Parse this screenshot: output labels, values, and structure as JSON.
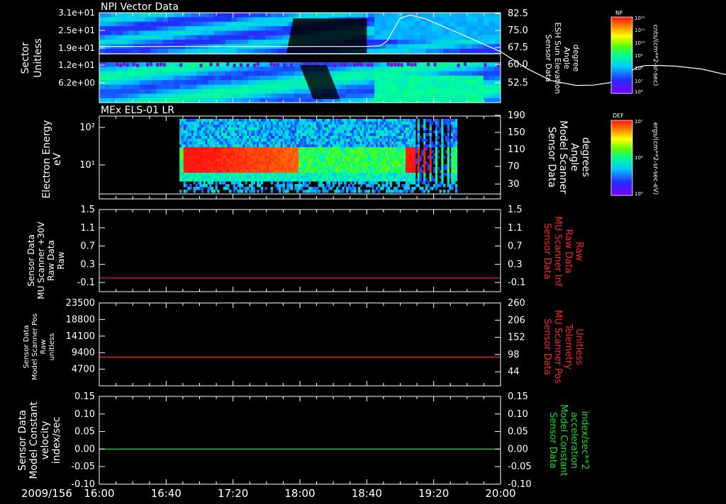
{
  "footer": {
    "date_label": "2009/156",
    "time_ticks": [
      "16:00",
      "16:40",
      "17:20",
      "18:00",
      "18:40",
      "19:20",
      "20:00"
    ]
  },
  "colorbars": [
    {
      "code": "NF",
      "tick_top": "10¹²",
      "tick_bottom": "10⁸",
      "ticks": [
        "10¹²",
        "10¹¹",
        "10¹⁰",
        "10⁹",
        "10⁸",
        "10⁷",
        "10⁶"
      ],
      "unit": "cnts/(cm**2-sr-sec)"
    },
    {
      "code": "DEF",
      "tick_top": "10⁷",
      "tick_bottom": "10⁵",
      "ticks": [
        "10⁷",
        "10⁶",
        "10⁵"
      ],
      "unit": "ergs/(cm**2-sr-sec-eV)"
    }
  ],
  "chart_data": [
    {
      "type": "heatmap",
      "title": "NPI Vector Data",
      "ylabel": [
        "Sector",
        "Unitless"
      ],
      "y_ticks_left": [
        "3.1e+01",
        "2.5e+01",
        "1.9e+01",
        "1.2e+01",
        "6.2e+00"
      ],
      "y_ticks_right": [
        "82.5",
        "75.0",
        "67.5",
        "60.0",
        "52.5"
      ],
      "ylabel_right": [
        "Sensor Data",
        "ESH Sun Elevation",
        "Angle",
        "degree"
      ],
      "overlay_series": {
        "name": "ESH Sun Elevation Angle",
        "x_minutes": [
          0,
          150,
          160,
          168,
          172,
          176,
          180,
          186,
          195,
          215,
          240,
          255,
          270,
          285,
          295,
          305,
          310,
          315,
          318,
          320,
          322,
          326,
          330,
          335,
          345,
          360,
          375,
          385,
          390,
          395,
          400,
          410,
          415,
          418,
          420,
          423,
          428,
          432,
          440
        ],
        "y_degrees": [
          68.2,
          68.2,
          68.2,
          68.5,
          70.5,
          75.5,
          80.5,
          81.8,
          80.2,
          74,
          66,
          59,
          53.5,
          51.4,
          51.5,
          52.5,
          54,
          56,
          57.5,
          58.5,
          59.3,
          59.9,
          60,
          60,
          59.7,
          58.5,
          56,
          53,
          51,
          49.5,
          48.5,
          49,
          54,
          60,
          64,
          68,
          68.2,
          68.2,
          68.2
        ]
      },
      "x_ticks": [
        "16:00",
        "16:40",
        "17:20",
        "18:00",
        "18:40",
        "19:20",
        "20:00"
      ],
      "colorbar": "NF"
    },
    {
      "type": "heatmap",
      "title": "MEx ELS-01 LR",
      "ylabel": [
        "Electron Energy",
        "eV"
      ],
      "y_ticks_left": [
        "10²",
        "10¹"
      ],
      "y_ticks_right": [
        "190",
        "150",
        "110",
        "70",
        "30"
      ],
      "ylabel_right": [
        "Sensor Data",
        "Model Scanner",
        "Angle",
        "degrees"
      ],
      "data_window": {
        "start": "16:48",
        "end": "19:34"
      },
      "high_flux_intervals": [
        {
          "start": "16:50",
          "end": "16:54"
        },
        {
          "start": "16:55",
          "end": "17:58"
        },
        {
          "start": "19:02",
          "end": "19:18"
        }
      ],
      "overlay_series": {
        "name": "Model Scanner Angle",
        "value_degrees": 10
      },
      "colorbar": "DEF"
    },
    {
      "type": "line",
      "ylabel": [
        "Sensor Data",
        "MU Scanner +30V",
        "Raw Data",
        "Raw"
      ],
      "ylabel_right": [
        "Sensor Data",
        "MU Scanner Inf",
        "Raw Data",
        "Raw"
      ],
      "y_ticks_left": [
        "1.5",
        "1.1",
        "0.7",
        "0.3",
        "-0.1"
      ],
      "y_ticks_right": [
        "1.5",
        "1.1",
        "0.7",
        "0.3",
        "-0.1"
      ],
      "ylim": [
        -0.3,
        1.5
      ],
      "series": [
        {
          "name": "MU Scanner Inf",
          "color": "#ff2020",
          "value": 0
        }
      ]
    },
    {
      "type": "line",
      "ylabel": [
        "Sensor Data",
        "Model Scanner Pos",
        "Raw",
        "unitless"
      ],
      "ylabel_right": [
        "Sensor Data",
        "MU Scanner Pos",
        "Telemetry",
        "Unitless"
      ],
      "y_ticks_left": [
        "23500",
        "18800",
        "14100",
        "9400",
        "4700"
      ],
      "y_ticks_right": [
        "260",
        "206",
        "152",
        "98",
        "44"
      ],
      "ylim": [
        0,
        23500
      ],
      "right_ylim": [
        0,
        260
      ],
      "series": [
        {
          "name": "MU Scanner Pos",
          "color": "#ff2020",
          "value": 90
        }
      ]
    },
    {
      "type": "line",
      "ylabel": [
        "Sensor Data",
        "Model Constant",
        "velocity",
        "index/sec"
      ],
      "ylabel_right": [
        "Sensor Data",
        "Model Constant",
        "acceleration",
        "index/sec**2"
      ],
      "y_ticks_left": [
        "0.15",
        "0.10",
        "0.05",
        "0.00",
        "-0.05",
        "-0.10"
      ],
      "y_ticks_right": [
        "0.15",
        "0.10",
        "0.05",
        "0.00",
        "-0.05",
        "-0.10"
      ],
      "ylim": [
        -0.1,
        0.15
      ],
      "series": [
        {
          "name": "Model Constant acceleration",
          "color": "#10e010",
          "value": 0
        }
      ]
    }
  ]
}
